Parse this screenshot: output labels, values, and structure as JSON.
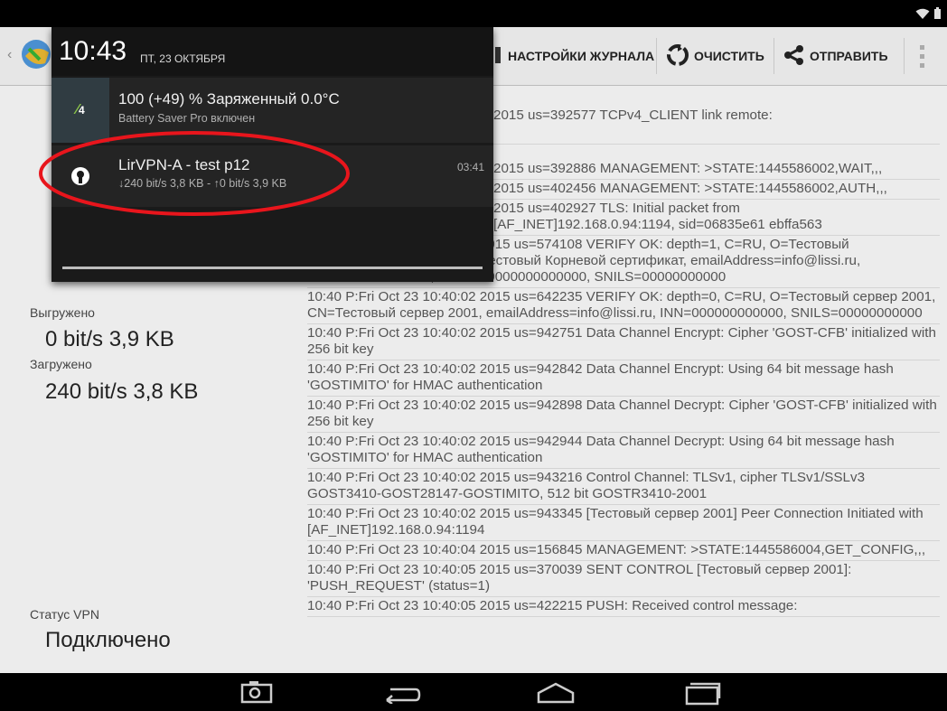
{
  "toolbar": {
    "journal_settings": "НАСТРОЙКИ ЖУРНАЛА",
    "clear": "ОЧИСТИТЬ",
    "send": "ОТПРАВИТЬ"
  },
  "stats": {
    "uploaded_label": "Выгружено",
    "uploaded_value": "0 bit/s 3,9 KB",
    "downloaded_label": "Загружено",
    "downloaded_value": "240 bit/s 3,8 KB",
    "vpn_status_label": "Статус VPN",
    "vpn_status_value": "Подключено"
  },
  "log": [
    "2015 us=392577 TCPv4_CLIENT link remote:",
    "2015 us=392886 MANAGEMENT: >STATE:1445586002,WAIT,,,",
    "2015 us=402456 MANAGEMENT: >STATE:1445586002,AUTH,,,",
    "2015 us=402927 TLS: Initial packet from\n[AF_INET]192.168.0.94:1194, sid=06835e61 ebffa563",
    "10:40 P:Fri Oct 23 10:40:02 2015 us=574108 VERIFY OK: depth=1, C=RU, O=Тестовый\nКорневой сертификат, CN=Тестовый Корневой сертификат, emailAddress=info@lissi.ru,\nINN=000000000000, OGRN=0000000000000, SNILS=00000000000",
    "10:40 P:Fri Oct 23 10:40:02 2015 us=642235 VERIFY OK: depth=0, C=RU, O=Тестовый сервер 2001, CN=Тестовый сервер 2001, emailAddress=info@lissi.ru, INN=000000000000, SNILS=00000000000",
    "10:40 P:Fri Oct 23 10:40:02 2015 us=942751 Data Channel Encrypt: Cipher 'GOST-CFB' initialized with 256 bit key",
    "10:40 P:Fri Oct 23 10:40:02 2015 us=942842 Data Channel Encrypt: Using 64 bit message hash 'GOSTIMITO' for HMAC authentication",
    "10:40 P:Fri Oct 23 10:40:02 2015 us=942898 Data Channel Decrypt: Cipher 'GOST-CFB' initialized with 256 bit key",
    "10:40 P:Fri Oct 23 10:40:02 2015 us=942944 Data Channel Decrypt: Using 64 bit message hash 'GOSTIMITO' for HMAC authentication",
    "10:40 P:Fri Oct 23 10:40:02 2015 us=943216 Control Channel: TLSv1, cipher TLSv1/SSLv3 GOST3410-GOST28147-GOSTIMITO, 512 bit GOSTR3410-2001",
    "10:40 P:Fri Oct 23 10:40:02 2015 us=943345 [Тестовый сервер 2001] Peer Connection Initiated with [AF_INET]192.168.0.94:1194",
    "10:40 P:Fri Oct 23 10:40:04 2015 us=156845 MANAGEMENT: >STATE:1445586004,GET_CONFIG,,,",
    "10:40 P:Fri Oct 23 10:40:05 2015 us=370039 SENT CONTROL [Тестовый сервер 2001]: 'PUSH_REQUEST' (status=1)",
    "10:40 P:Fri Oct 23 10:40:05 2015 us=422215 PUSH: Received control message:"
  ],
  "shade": {
    "time": "10:43",
    "date": "ПТ, 23 ОКТЯБРЯ",
    "notif1_title": "100 (+49) % Заряженный 0.0°C",
    "notif1_text": "Battery Saver Pro включен",
    "notif1_icon_digit": "4",
    "notif2_title": "LirVPN-A - test p12",
    "notif2_text": "↓240 bit/s 3,8 KB - ↑0 bit/s 3,9 KB",
    "notif2_time": "03:41"
  },
  "colors": {
    "annotation_red": "#e8151c",
    "battery_green": "#8bc34a"
  }
}
